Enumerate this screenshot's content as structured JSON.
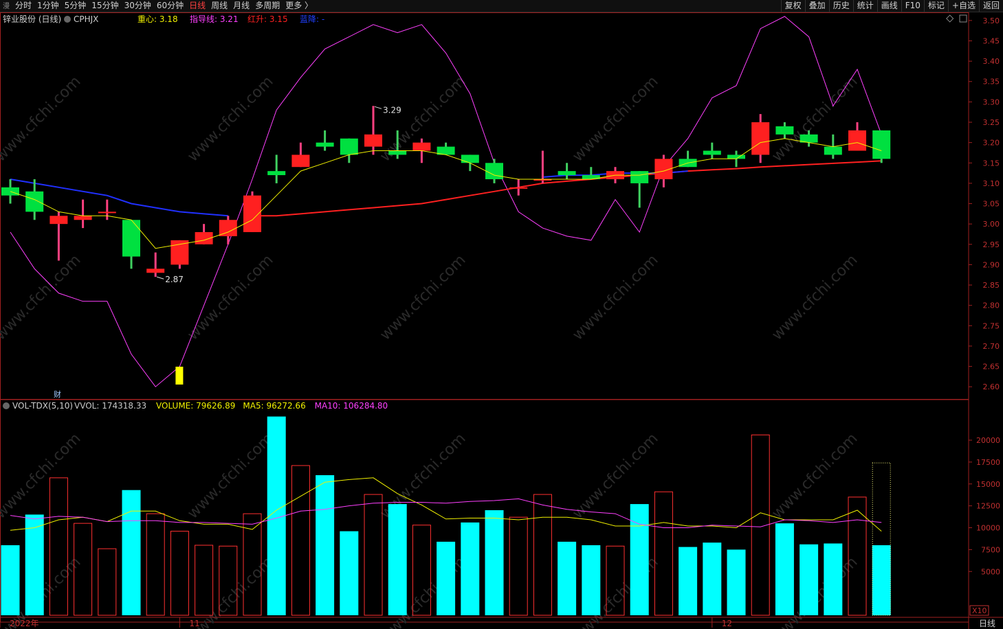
{
  "toolbar": {
    "menu_glyph": "漫",
    "tabs": [
      "分时",
      "1分钟",
      "5分钟",
      "15分钟",
      "30分钟",
      "60分钟",
      "日线",
      "周线",
      "月线",
      "多周期",
      "更多 〉"
    ],
    "active_tab": 6,
    "tools": [
      "复权",
      "叠加",
      "历史",
      "统计",
      "画线",
      "F10",
      "标记",
      "+自选",
      "返回"
    ]
  },
  "price_panel": {
    "stock_title": "锌业股份 (日线)",
    "indicator": "CPHJX",
    "legend": [
      {
        "label": "重心: 3.18",
        "color": "#f0f000"
      },
      {
        "label": "指导线: 3.21",
        "color": "#ff40ff"
      },
      {
        "label": "红升: 3.15",
        "color": "#ff2020"
      },
      {
        "label": "蓝降: -",
        "color": "#2040ff"
      }
    ],
    "high_label": "3.29",
    "low_label": "2.87",
    "cai_badge": "财"
  },
  "volume_panel": {
    "indicator": "VOL-TDX(5,10)",
    "legend": [
      {
        "label": "VVOL: 174318.33",
        "color": "#c8c8c8"
      },
      {
        "label": "VOLUME: 79626.89",
        "color": "#f0f000"
      },
      {
        "label": "MA5: 96272.66",
        "color": "#f0f000"
      },
      {
        "label": "MA10: 106284.80",
        "color": "#ff40ff"
      }
    ],
    "unit_badge": "X10"
  },
  "x_axis": {
    "labels": [
      "2022年",
      "11",
      "12"
    ],
    "period_label": "日线"
  },
  "watermark": "www.cfchi.com",
  "colors": {
    "up": "#ff2020",
    "down": "#00e040",
    "vol_down": "#00ffff",
    "ma": "#f0f000",
    "guide": "#ff40ff",
    "red_line": "#ff2020",
    "blue_line": "#2030ff",
    "axis": "#a02020"
  },
  "chart_data": [
    {
      "type": "candlestick",
      "title": "锌业股份 (日线)",
      "ylim": [
        2.57,
        3.52
      ],
      "y_ticks": [
        2.6,
        2.65,
        2.7,
        2.75,
        2.8,
        2.85,
        2.9,
        2.95,
        3.0,
        3.05,
        3.1,
        3.15,
        3.2,
        3.25,
        3.3,
        3.35,
        3.4,
        3.45,
        3.5
      ],
      "candles": [
        {
          "o": 3.09,
          "h": 3.11,
          "l": 3.05,
          "c": 3.07
        },
        {
          "o": 3.08,
          "h": 3.11,
          "l": 3.01,
          "c": 3.03
        },
        {
          "o": 3.0,
          "h": 3.03,
          "l": 2.91,
          "c": 3.02
        },
        {
          "o": 3.01,
          "h": 3.06,
          "l": 2.99,
          "c": 3.02
        },
        {
          "o": 3.03,
          "h": 3.06,
          "l": 3.01,
          "c": 3.03
        },
        {
          "o": 3.01,
          "h": 3.01,
          "l": 2.89,
          "c": 2.92
        },
        {
          "o": 2.88,
          "h": 2.93,
          "l": 2.87,
          "c": 2.89
        },
        {
          "o": 2.9,
          "h": 2.96,
          "l": 2.89,
          "c": 2.96
        },
        {
          "o": 2.95,
          "h": 3.0,
          "l": 2.95,
          "c": 2.98
        },
        {
          "o": 2.97,
          "h": 3.02,
          "l": 2.95,
          "c": 3.01
        },
        {
          "o": 2.98,
          "h": 3.08,
          "l": 2.98,
          "c": 3.07
        },
        {
          "o": 3.13,
          "h": 3.17,
          "l": 3.1,
          "c": 3.12
        },
        {
          "o": 3.14,
          "h": 3.2,
          "l": 3.14,
          "c": 3.17
        },
        {
          "o": 3.2,
          "h": 3.23,
          "l": 3.18,
          "c": 3.19
        },
        {
          "o": 3.21,
          "h": 3.21,
          "l": 3.15,
          "c": 3.17
        },
        {
          "o": 3.19,
          "h": 3.29,
          "l": 3.17,
          "c": 3.22
        },
        {
          "o": 3.18,
          "h": 3.23,
          "l": 3.16,
          "c": 3.17
        },
        {
          "o": 3.18,
          "h": 3.21,
          "l": 3.15,
          "c": 3.2
        },
        {
          "o": 3.19,
          "h": 3.2,
          "l": 3.17,
          "c": 3.17
        },
        {
          "o": 3.17,
          "h": 3.17,
          "l": 3.13,
          "c": 3.15
        },
        {
          "o": 3.15,
          "h": 3.16,
          "l": 3.1,
          "c": 3.11
        },
        {
          "o": 3.09,
          "h": 3.11,
          "l": 3.07,
          "c": 3.09
        },
        {
          "o": 3.11,
          "h": 3.18,
          "l": 3.1,
          "c": 3.11
        },
        {
          "o": 3.13,
          "h": 3.15,
          "l": 3.11,
          "c": 3.12
        },
        {
          "o": 3.12,
          "h": 3.14,
          "l": 3.11,
          "c": 3.11
        },
        {
          "o": 3.11,
          "h": 3.14,
          "l": 3.1,
          "c": 3.13
        },
        {
          "o": 3.13,
          "h": 3.13,
          "l": 3.04,
          "c": 3.1
        },
        {
          "o": 3.11,
          "h": 3.17,
          "l": 3.09,
          "c": 3.16
        },
        {
          "o": 3.16,
          "h": 3.18,
          "l": 3.14,
          "c": 3.14
        },
        {
          "o": 3.18,
          "h": 3.2,
          "l": 3.16,
          "c": 3.17
        },
        {
          "o": 3.17,
          "h": 3.18,
          "l": 3.14,
          "c": 3.16
        },
        {
          "o": 3.17,
          "h": 3.27,
          "l": 3.15,
          "c": 3.25
        },
        {
          "o": 3.24,
          "h": 3.25,
          "l": 3.21,
          "c": 3.22
        },
        {
          "o": 3.22,
          "h": 3.23,
          "l": 3.19,
          "c": 3.2
        },
        {
          "o": 3.19,
          "h": 3.22,
          "l": 3.16,
          "c": 3.17
        },
        {
          "o": 3.18,
          "h": 3.25,
          "l": 3.18,
          "c": 3.23
        },
        {
          "o": 3.23,
          "h": 3.23,
          "l": 3.15,
          "c": 3.16
        }
      ],
      "series": [
        {
          "name": "重心",
          "values": [
            3.08,
            3.06,
            3.03,
            3.02,
            3.02,
            3.01,
            2.94,
            2.95,
            2.96,
            2.98,
            3.01,
            3.07,
            3.13,
            3.15,
            3.17,
            3.18,
            3.18,
            3.18,
            3.17,
            3.15,
            3.12,
            3.11,
            3.11,
            3.11,
            3.11,
            3.12,
            3.12,
            3.13,
            3.15,
            3.16,
            3.16,
            3.2,
            3.21,
            3.2,
            3.19,
            3.2,
            3.18
          ]
        },
        {
          "name": "指导线",
          "values": [
            2.98,
            2.89,
            2.83,
            2.81,
            2.81,
            2.68,
            2.6,
            2.65,
            2.8,
            2.95,
            3.11,
            3.28,
            3.36,
            3.43,
            3.46,
            3.49,
            3.47,
            3.49,
            3.42,
            3.32,
            3.15,
            3.03,
            2.99,
            2.97,
            2.96,
            3.06,
            2.98,
            3.14,
            3.21,
            3.31,
            3.34,
            3.48,
            3.51,
            3.46,
            3.29,
            3.38,
            3.22
          ]
        },
        {
          "name": "红升",
          "values": [
            null,
            null,
            null,
            null,
            null,
            null,
            null,
            null,
            null,
            null,
            3.02,
            3.02,
            3.025,
            3.03,
            3.035,
            3.04,
            3.045,
            3.05,
            3.06,
            3.07,
            3.08,
            3.09,
            3.1,
            3.105,
            3.11,
            3.115,
            3.12,
            3.125,
            3.13,
            3.133,
            3.136,
            3.14,
            3.143,
            3.146,
            3.149,
            3.152,
            3.155
          ]
        },
        {
          "name": "蓝降",
          "values": [
            3.11,
            3.1,
            3.09,
            3.08,
            3.07,
            3.05,
            3.04,
            3.03,
            3.025,
            3.02,
            null,
            null,
            null,
            null,
            null,
            null,
            null,
            null,
            null,
            null,
            null,
            null,
            3.115,
            3.12,
            3.12,
            3.125,
            3.125,
            3.125,
            3.13,
            null,
            null,
            null,
            null,
            null,
            null,
            null,
            null
          ]
        }
      ]
    },
    {
      "type": "bar",
      "title": "VOL-TDX(5,10)",
      "ylim": [
        0,
        24000
      ],
      "y_ticks": [
        5000,
        7500,
        10000,
        12500,
        15000,
        17500,
        20000
      ],
      "values": [
        8000,
        11500,
        15700,
        10500,
        7600,
        14300,
        11600,
        9600,
        8000,
        7900,
        11600,
        22700,
        17100,
        16000,
        9600,
        13800,
        12700,
        10300,
        8400,
        10600,
        12000,
        11200,
        13800,
        8400,
        8000,
        7900,
        12700,
        14100,
        7800,
        8300,
        7500,
        20600,
        10500,
        8100,
        8200,
        13500,
        8000
      ],
      "series": [
        {
          "name": "MA5",
          "values": [
            9700,
            10000,
            10900,
            11200,
            10700,
            11900,
            11900,
            10800,
            10400,
            10400,
            9800,
            12000,
            13600,
            15200,
            15500,
            15700,
            13900,
            12600,
            11000,
            11100,
            11100,
            10900,
            11200,
            11200,
            10900,
            10200,
            10200,
            10600,
            10200,
            10200,
            10000,
            11700,
            10900,
            10900,
            10900,
            12000,
            9600
          ]
        },
        {
          "name": "MA10",
          "values": [
            11400,
            11000,
            11300,
            11200,
            10700,
            10800,
            10800,
            10600,
            10600,
            10500,
            10400,
            11100,
            11900,
            12100,
            12500,
            12800,
            12900,
            12900,
            12800,
            13000,
            13100,
            13300,
            12600,
            12100,
            11800,
            11600,
            10400,
            10000,
            10000,
            10300,
            10200,
            10100,
            10900,
            10800,
            10600,
            10900,
            10600
          ]
        }
      ]
    }
  ]
}
